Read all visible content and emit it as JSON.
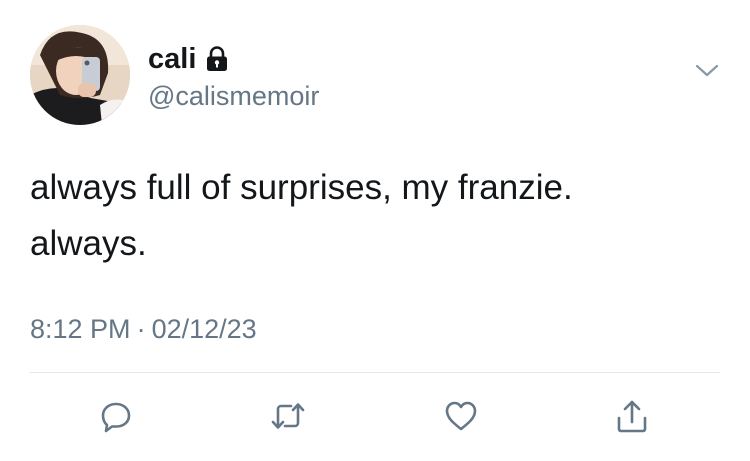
{
  "tweet": {
    "display_name": "cali",
    "handle": "@calismemoir",
    "text_lines": [
      "always full of surprises, my franzie.",
      "always."
    ],
    "time": "8:12 PM",
    "separator": "·",
    "date": "02/12/23"
  },
  "icons": {
    "lock": "lock-icon",
    "menu": "chevron-down-icon",
    "reply": "reply-icon",
    "retweet": "retweet-icon",
    "like": "heart-icon",
    "share": "share-icon"
  },
  "colors": {
    "text": "#14171a",
    "secondary": "#657786",
    "divider": "#e1e8ed",
    "action_icon": "#657786"
  }
}
